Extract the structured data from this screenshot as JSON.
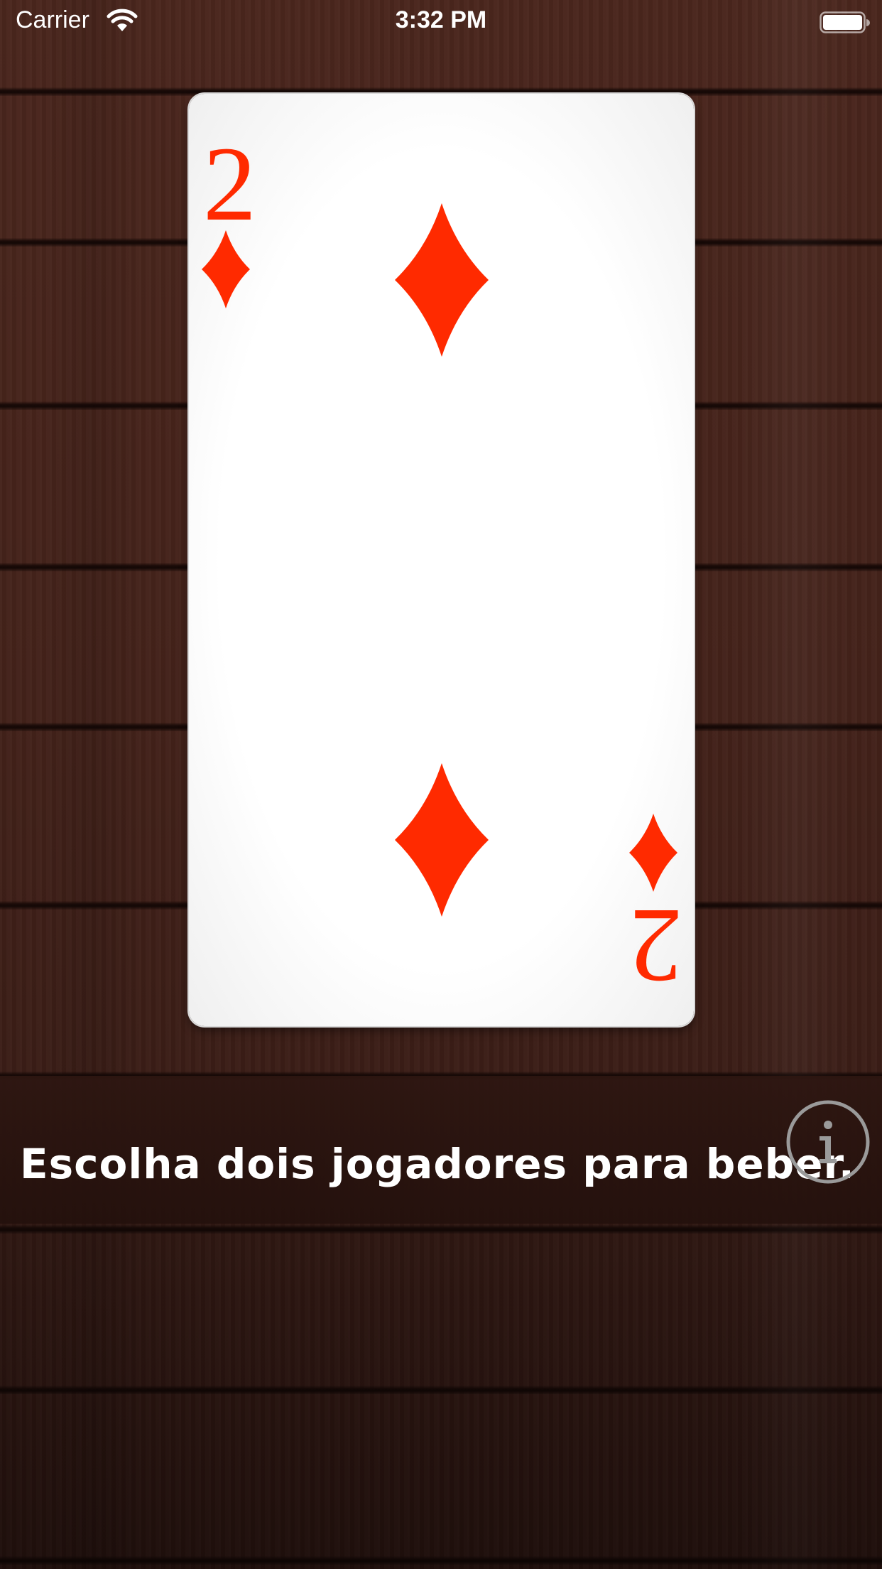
{
  "status_bar": {
    "carrier": "Carrier",
    "time": "3:32 PM",
    "wifi_icon": "wifi-icon",
    "battery_icon": "battery-icon"
  },
  "card": {
    "rank": "2",
    "suit": "diamonds",
    "suit_color": "#ff2a00"
  },
  "caption": {
    "text": "Escolha dois jogadores para beber."
  },
  "info_button": {
    "icon": "info-icon"
  },
  "colors": {
    "wood": "#43221a",
    "seam": "#150907",
    "card": "#ffffff",
    "info_ring": "#9a9a9a"
  }
}
